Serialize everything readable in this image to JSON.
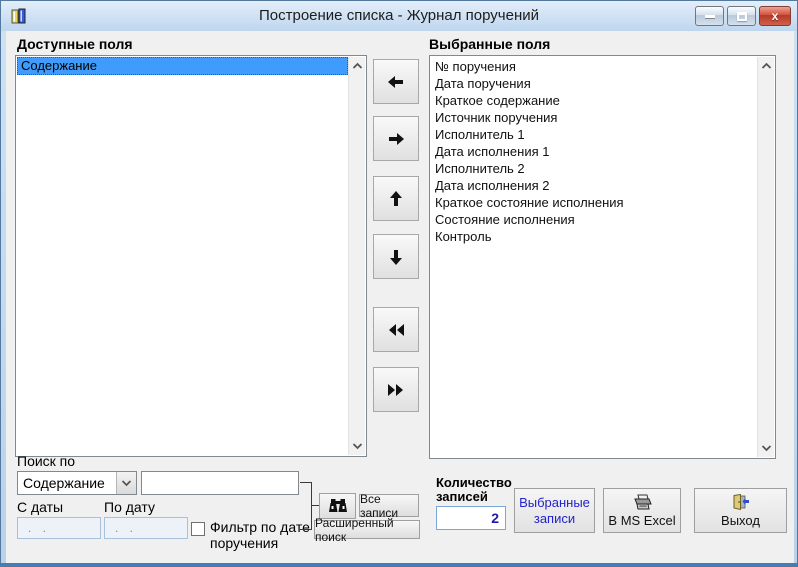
{
  "window": {
    "title": "Построение списка - Журнал поручений",
    "app_icon": "books-icon",
    "caption_buttons": [
      "minimize",
      "maximize",
      "close"
    ],
    "close_glyph": "x"
  },
  "available_panel": {
    "label": "Доступные поля",
    "items": [
      "Содержание"
    ],
    "selected": "Содержание"
  },
  "selected_panel": {
    "label": "Выбранные поля",
    "items": [
      "№ поручения",
      "Дата поручения",
      "Краткое содержание",
      "Источник поручения",
      "Исполнитель 1",
      "Дата исполнения 1",
      "Исполнитель 2",
      "Дата исполнения 2",
      "Краткое состояние исполнения",
      "Состояние исполнения",
      "Контроль"
    ]
  },
  "transfer_icons": [
    "arrow-left",
    "arrow-right",
    "arrow-up",
    "arrow-down",
    "double-arrow-left",
    "double-arrow-right"
  ],
  "search": {
    "label": "Поиск по",
    "field_select_value": "Содержание",
    "query_value": "",
    "from_date_label": "С даты",
    "to_date_label": "По дату",
    "date_mask": ". .",
    "from_date_value": "",
    "to_date_value": "",
    "date_filter_checkbox_label": "Фильтр по дате поручения",
    "date_filter_checked": false,
    "find_button_icon": "binoculars-icon",
    "all_records_button": "Все записи",
    "advanced_search_button": "Расширенный поиск"
  },
  "records": {
    "count_label": "Количество записей",
    "count_value": "2",
    "selected_records_button": "Выбранные записи",
    "excel_button": "В MS Excel",
    "excel_button_icon": "printer-icon",
    "exit_button": "Выход",
    "exit_button_icon": "exit-door-icon"
  },
  "colors": {
    "selection_blue": "#3F9CFD",
    "titlebar_blue": "#C3D8EF",
    "frame_blue": "#BDD4EB",
    "link_blue": "#2323CC",
    "close_red": "#C0392B",
    "client_gray": "#F0F0F0"
  }
}
